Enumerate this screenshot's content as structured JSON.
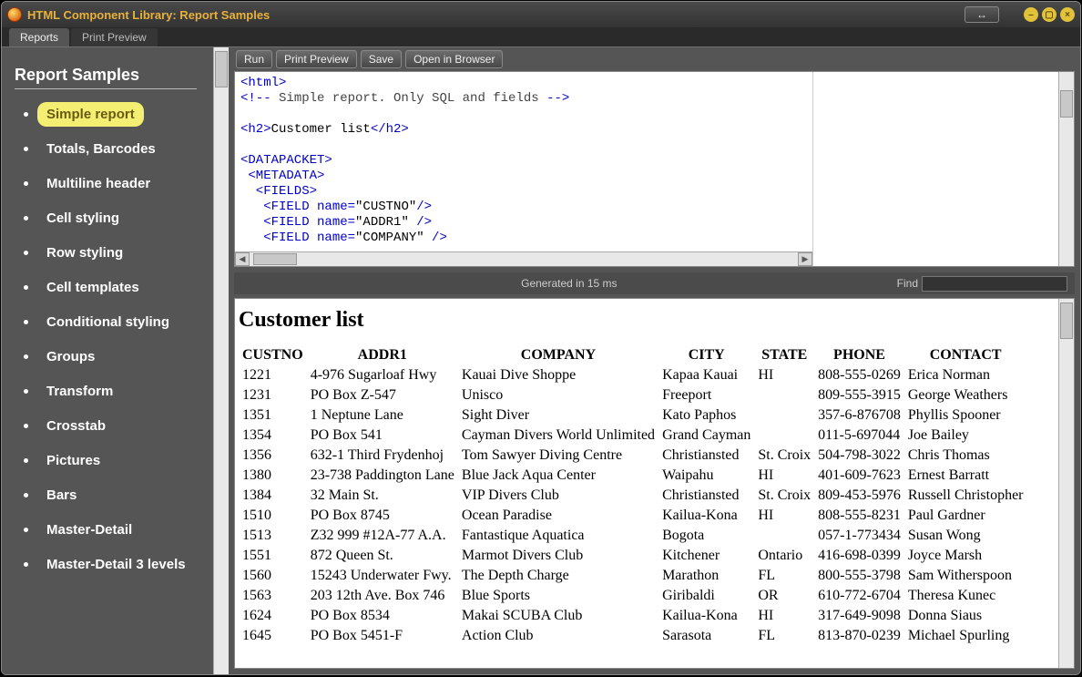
{
  "window": {
    "title": "HTML Component Library: Report Samples"
  },
  "tabs": [
    {
      "label": "Reports",
      "active": true
    },
    {
      "label": "Print Preview",
      "active": false
    }
  ],
  "sidebar": {
    "title": "Report Samples",
    "items": [
      {
        "label": "Simple report",
        "selected": true
      },
      {
        "label": "Totals, Barcodes"
      },
      {
        "label": "Multiline header"
      },
      {
        "label": "Cell styling"
      },
      {
        "label": "Row styling"
      },
      {
        "label": "Cell templates"
      },
      {
        "label": "Conditional styling"
      },
      {
        "label": "Groups"
      },
      {
        "label": "Transform"
      },
      {
        "label": "Crosstab"
      },
      {
        "label": "Pictures"
      },
      {
        "label": "Bars"
      },
      {
        "label": "Master-Detail"
      },
      {
        "label": "Master-Detail 3 levels"
      }
    ]
  },
  "toolbar": {
    "run": "Run",
    "print_preview": "Print Preview",
    "save": "Save",
    "open_browser": "Open in Browser"
  },
  "code": {
    "l1": "<html>",
    "l2a": "<!--",
    "l2b": " Simple report. Only SQL and fields ",
    "l2c": "-->",
    "l3a": "<h2>",
    "l3b": "Customer list",
    "l3c": "</h2>",
    "l4": "<DATAPACKET>",
    "l5": " <METADATA>",
    "l6": "  <FIELDS>",
    "l7a": "   <FIELD name=",
    "l7b": "\"CUSTNO\"",
    "l7c": "/>",
    "l8a": "   <FIELD name=",
    "l8b": "\"ADDR1\" ",
    "l8c": "/>",
    "l9a": "   <FIELD name=",
    "l9b": "\"COMPANY\" ",
    "l9c": "/>"
  },
  "status": {
    "generated": "Generated in 15 ms",
    "find_label": "Find"
  },
  "preview": {
    "heading": "Customer list",
    "columns": [
      "CUSTNO",
      "ADDR1",
      "COMPANY",
      "CITY",
      "STATE",
      "PHONE",
      "CONTACT"
    ],
    "rows": [
      [
        "1221",
        "4-976 Sugarloaf Hwy",
        "Kauai Dive Shoppe",
        "Kapaa Kauai",
        "HI",
        "808-555-0269",
        "Erica Norman"
      ],
      [
        "1231",
        "PO Box Z-547",
        "Unisco",
        "Freeport",
        "",
        "809-555-3915",
        "George Weathers"
      ],
      [
        "1351",
        "1 Neptune Lane",
        "Sight Diver",
        "Kato Paphos",
        "",
        "357-6-876708",
        "Phyllis Spooner"
      ],
      [
        "1354",
        "PO Box 541",
        "Cayman Divers World Unlimited",
        "Grand Cayman",
        "",
        "011-5-697044",
        "Joe Bailey"
      ],
      [
        "1356",
        "632-1 Third Frydenhoj",
        "Tom Sawyer Diving Centre",
        "Christiansted",
        "St. Croix",
        "504-798-3022",
        "Chris Thomas"
      ],
      [
        "1380",
        "23-738 Paddington Lane",
        "Blue Jack Aqua Center",
        "Waipahu",
        "HI",
        "401-609-7623",
        "Ernest Barratt"
      ],
      [
        "1384",
        "32 Main St.",
        "VIP Divers Club",
        "Christiansted",
        "St. Croix",
        "809-453-5976",
        "Russell Christopher"
      ],
      [
        "1510",
        "PO Box 8745",
        "Ocean Paradise",
        "Kailua-Kona",
        "HI",
        "808-555-8231",
        "Paul Gardner"
      ],
      [
        "1513",
        "Z32 999 #12A-77 A.A.",
        "Fantastique Aquatica",
        "Bogota",
        "",
        "057-1-773434",
        "Susan Wong"
      ],
      [
        "1551",
        "872 Queen St.",
        "Marmot Divers Club",
        "Kitchener",
        "Ontario",
        "416-698-0399",
        "Joyce Marsh"
      ],
      [
        "1560",
        "15243 Underwater Fwy.",
        "The Depth Charge",
        "Marathon",
        "FL",
        "800-555-3798",
        "Sam Witherspoon"
      ],
      [
        "1563",
        "203 12th Ave. Box 746",
        "Blue Sports",
        "Giribaldi",
        "OR",
        "610-772-6704",
        "Theresa Kunec"
      ],
      [
        "1624",
        "PO Box 8534",
        "Makai SCUBA Club",
        "Kailua-Kona",
        "HI",
        "317-649-9098",
        "Donna Siaus"
      ],
      [
        "1645",
        "PO Box 5451-F",
        "Action Club",
        "Sarasota",
        "FL",
        "813-870-0239",
        "Michael Spurling"
      ]
    ]
  }
}
